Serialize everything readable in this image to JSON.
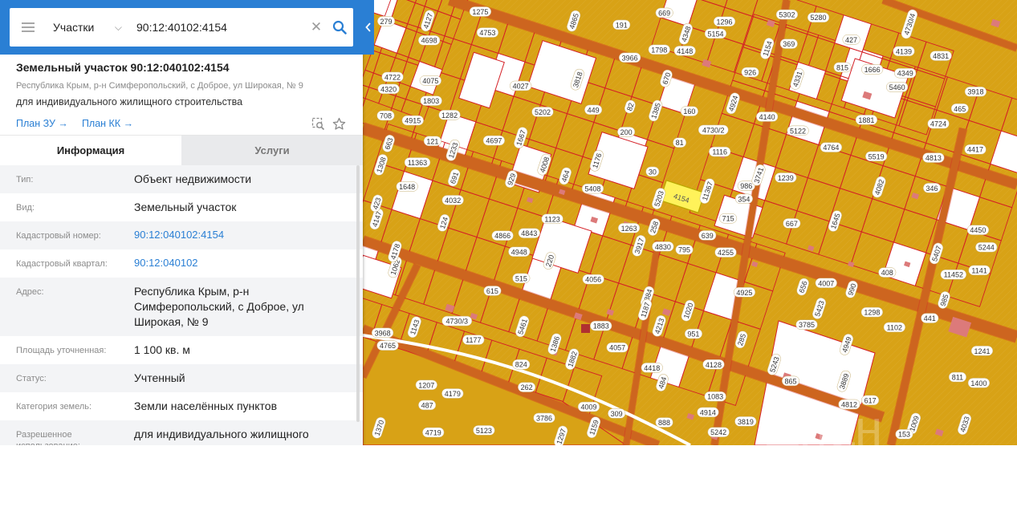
{
  "search": {
    "category": "Участки",
    "query": "90:12:40102:4154"
  },
  "parcel": {
    "title": "Земельный участок 90:12:040102:4154",
    "address": "Республика Крым, р-н Симферопольский, с Доброе, ул Широкая, № 9",
    "purpose": "для индивидуального жилищного строительства",
    "plan_zu": "План ЗУ →",
    "plan_kk": "План КК →"
  },
  "tabs": [
    {
      "label": "Информация"
    },
    {
      "label": "Услуги"
    }
  ],
  "info_rows": [
    {
      "label": "Тип:",
      "value": "Объект недвижимости"
    },
    {
      "label": "Вид:",
      "value": "Земельный участок"
    },
    {
      "label": "Кадастровый номер:",
      "value": "90:12:040102:4154"
    },
    {
      "label": "Кадастровый квартал:",
      "value": "90:12:040102"
    },
    {
      "label": "Адрес:",
      "value": "Республика Крым, р-н Симферопольский, с Доброе, ул Широкая, № 9"
    },
    {
      "label": "Площадь уточненная:",
      "value": "1 100 кв. м"
    },
    {
      "label": "Статус:",
      "value": "Учтенный"
    },
    {
      "label": "Категория земель:",
      "value": "Земли населённых пунктов"
    },
    {
      "label": "Разрешенное использование:",
      "value": "для индивидуального жилищного"
    }
  ],
  "map": {
    "highlighted": "4154",
    "watermark": "Циан",
    "labels": [
      "4154",
      "795",
      "1282",
      "258",
      "1207",
      "986",
      "1386",
      "369",
      "160",
      "4331",
      "715",
      "4753",
      "4033",
      "4032",
      "3918",
      "3917",
      "5122",
      "5123",
      "1385",
      "1116",
      "1177",
      "1176",
      "487",
      "262",
      "990",
      "1798",
      "1648",
      "656",
      "4417",
      "4418",
      "5203",
      "5202",
      "815",
      "1009",
      "811",
      "1296",
      "929",
      "3785",
      "3786",
      "1308",
      "354",
      "4719",
      "484",
      "4724",
      "4722",
      "5423",
      "865",
      "824",
      "4127",
      "4128",
      "4349",
      "4348",
      "1123",
      "11363",
      "1667",
      "1666",
      "1275",
      "1154",
      "3966",
      "3968",
      "4213",
      "4009",
      "4007",
      "4008",
      "4698",
      "4697",
      "1062",
      "30",
      "1083",
      "11367",
      "4179",
      "667",
      "985",
      "888",
      "346",
      "1020",
      "617",
      "5242",
      "5243",
      "5244",
      "1239",
      "4949",
      "441",
      "4866",
      "4865",
      "4450",
      "615",
      "5461",
      "5460",
      "5408",
      "5407",
      "4075",
      "1263",
      "1143",
      "4830",
      "4831",
      "82",
      "191",
      "4730/3",
      "4730/4",
      "4730/2",
      "449",
      "1645",
      "515",
      "309",
      "4082",
      "1803",
      "3819",
      "3818",
      "11452",
      "1298",
      "220",
      "1141",
      "4255",
      "691",
      "1102",
      "639",
      "3741",
      "4812",
      "4813",
      "1159",
      "408",
      "5154",
      "670",
      "81",
      "4843",
      "4924",
      "4925",
      "4148",
      "4147",
      "669",
      "121",
      "4884",
      "1400",
      "153",
      "663",
      "926",
      "708",
      "1233",
      "4915",
      "4914",
      "1882",
      "1883",
      "1881",
      "124",
      "427",
      "200",
      "423",
      "4764",
      "4765",
      "1187",
      "1241",
      "465",
      "464",
      "4057",
      "4056",
      "1370",
      "4140",
      "4139",
      "3889",
      "5302",
      "4320",
      "1297",
      "279",
      "4948",
      "4178",
      "5280",
      "951",
      "285",
      "4027",
      "5519"
    ]
  },
  "colors": {
    "accent": "#2a7fd4",
    "parcel_fill": "#d8a216",
    "parcel_border": "#d41f26",
    "highlight_fill": "#fff25a",
    "road": "#c98a1c",
    "building": "#dc7a7a"
  }
}
